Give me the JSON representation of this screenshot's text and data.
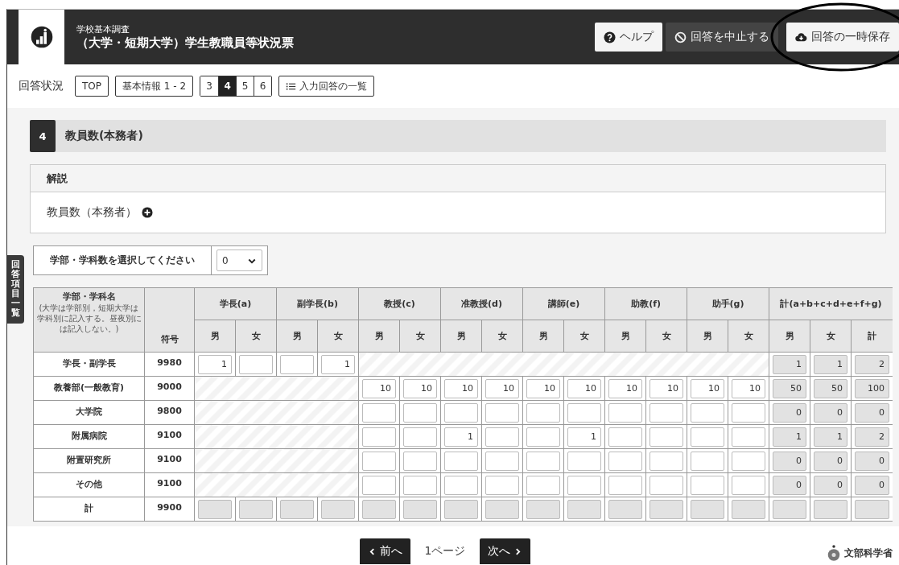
{
  "header": {
    "subtitle": "学校基本調査",
    "title": "（大学・短期大学）学生教職員等状況票",
    "buttons": [
      {
        "kind": "help",
        "label": "ヘルプ"
      },
      {
        "kind": "stop",
        "label": "回答を中止する"
      },
      {
        "kind": "save",
        "label": "回答の一時保存"
      }
    ]
  },
  "nav": {
    "status_label": "回答状況",
    "links": [
      "TOP",
      "基本情報 1 - 2"
    ],
    "pages": [
      {
        "label": "3",
        "selected": false
      },
      {
        "label": "4",
        "selected": true
      },
      {
        "label": "5",
        "selected": false
      },
      {
        "label": "6",
        "selected": false
      }
    ],
    "list_button": "入力回答の一覧"
  },
  "side_tab": "回答項目一覧",
  "section": {
    "number": "4",
    "title": "教員数(本務者)",
    "explanation": {
      "heading": "解説",
      "item": "教員数（本務者）"
    },
    "select": {
      "label": "学部・学科数を選択してください",
      "value": "0"
    }
  },
  "table": {
    "name_header": "学部・学科名",
    "name_note": "(大学は学部別，短期大学は学科別に記入する。昼夜別には記入しない。)",
    "code_header": "符号",
    "groups": [
      {
        "label": "学長(a)",
        "subs": [
          "男",
          "女"
        ]
      },
      {
        "label": "副学長(b)",
        "subs": [
          "男",
          "女"
        ]
      },
      {
        "label": "教授(c)",
        "subs": [
          "男",
          "女"
        ]
      },
      {
        "label": "准教授(d)",
        "subs": [
          "男",
          "女"
        ]
      },
      {
        "label": "講師(e)",
        "subs": [
          "男",
          "女"
        ]
      },
      {
        "label": "助教(f)",
        "subs": [
          "男",
          "女"
        ]
      },
      {
        "label": "助手(g)",
        "subs": [
          "男",
          "女"
        ]
      },
      {
        "label": "計(a+b+c+d+e+f+g)",
        "subs": [
          "男",
          "女",
          "計"
        ]
      }
    ],
    "rows": [
      {
        "name": "学長・副学長",
        "code": "9980",
        "cells": [
          {
            "kind": "input",
            "value": "1"
          },
          {
            "kind": "input"
          },
          {
            "kind": "input"
          },
          {
            "kind": "input",
            "value": "1"
          },
          {
            "kind": "hatched"
          },
          {
            "kind": "hatched"
          },
          {
            "kind": "hatched"
          },
          {
            "kind": "hatched"
          },
          {
            "kind": "hatched"
          },
          {
            "kind": "hatched"
          },
          {
            "kind": "hatched"
          },
          {
            "kind": "hatched"
          },
          {
            "kind": "hatched"
          },
          {
            "kind": "hatched"
          },
          {
            "kind": "total",
            "value": "1"
          },
          {
            "kind": "total",
            "value": "1"
          },
          {
            "kind": "total",
            "value": "2"
          }
        ]
      },
      {
        "name": "教養部(一般教育)",
        "code": "9000",
        "cells": [
          {
            "kind": "hatched"
          },
          {
            "kind": "hatched"
          },
          {
            "kind": "hatched"
          },
          {
            "kind": "hatched"
          },
          {
            "kind": "input",
            "value": "10"
          },
          {
            "kind": "input",
            "value": "10"
          },
          {
            "kind": "input",
            "value": "10"
          },
          {
            "kind": "input",
            "value": "10"
          },
          {
            "kind": "input",
            "value": "10"
          },
          {
            "kind": "input",
            "value": "10"
          },
          {
            "kind": "input",
            "value": "10"
          },
          {
            "kind": "input",
            "value": "10"
          },
          {
            "kind": "input",
            "value": "10"
          },
          {
            "kind": "input",
            "value": "10"
          },
          {
            "kind": "total",
            "value": "50"
          },
          {
            "kind": "total",
            "value": "50"
          },
          {
            "kind": "total",
            "value": "100"
          }
        ]
      },
      {
        "name": "大学院",
        "code": "9800",
        "cells": [
          {
            "kind": "hatched"
          },
          {
            "kind": "hatched"
          },
          {
            "kind": "hatched"
          },
          {
            "kind": "hatched"
          },
          {
            "kind": "input"
          },
          {
            "kind": "input"
          },
          {
            "kind": "input"
          },
          {
            "kind": "input"
          },
          {
            "kind": "input"
          },
          {
            "kind": "input"
          },
          {
            "kind": "input"
          },
          {
            "kind": "input"
          },
          {
            "kind": "input"
          },
          {
            "kind": "input"
          },
          {
            "kind": "total",
            "value": "0"
          },
          {
            "kind": "total",
            "value": "0"
          },
          {
            "kind": "total",
            "value": "0"
          }
        ]
      },
      {
        "name": "附属病院",
        "code": "9100",
        "cells": [
          {
            "kind": "hatched"
          },
          {
            "kind": "hatched"
          },
          {
            "kind": "hatched"
          },
          {
            "kind": "hatched"
          },
          {
            "kind": "input"
          },
          {
            "kind": "input"
          },
          {
            "kind": "input",
            "value": "1"
          },
          {
            "kind": "input"
          },
          {
            "kind": "input"
          },
          {
            "kind": "input",
            "value": "1"
          },
          {
            "kind": "input"
          },
          {
            "kind": "input"
          },
          {
            "kind": "input"
          },
          {
            "kind": "input"
          },
          {
            "kind": "total",
            "value": "1"
          },
          {
            "kind": "total",
            "value": "1"
          },
          {
            "kind": "total",
            "value": "2"
          }
        ]
      },
      {
        "name": "附置研究所",
        "code": "9100",
        "cells": [
          {
            "kind": "hatched"
          },
          {
            "kind": "hatched"
          },
          {
            "kind": "hatched"
          },
          {
            "kind": "hatched"
          },
          {
            "kind": "input"
          },
          {
            "kind": "input"
          },
          {
            "kind": "input"
          },
          {
            "kind": "input"
          },
          {
            "kind": "input"
          },
          {
            "kind": "input"
          },
          {
            "kind": "input"
          },
          {
            "kind": "input"
          },
          {
            "kind": "input"
          },
          {
            "kind": "input"
          },
          {
            "kind": "total",
            "value": "0"
          },
          {
            "kind": "total",
            "value": "0"
          },
          {
            "kind": "total",
            "value": "0"
          }
        ]
      },
      {
        "name": "その他",
        "code": "9100",
        "cells": [
          {
            "kind": "hatched"
          },
          {
            "kind": "hatched"
          },
          {
            "kind": "hatched"
          },
          {
            "kind": "hatched"
          },
          {
            "kind": "input"
          },
          {
            "kind": "input"
          },
          {
            "kind": "input"
          },
          {
            "kind": "input"
          },
          {
            "kind": "input"
          },
          {
            "kind": "input"
          },
          {
            "kind": "input"
          },
          {
            "kind": "input"
          },
          {
            "kind": "input"
          },
          {
            "kind": "input"
          },
          {
            "kind": "total",
            "value": "0"
          },
          {
            "kind": "total",
            "value": "0"
          },
          {
            "kind": "total",
            "value": "0"
          }
        ]
      },
      {
        "name": "計",
        "code": "9900",
        "cells": [
          {
            "kind": "total"
          },
          {
            "kind": "total"
          },
          {
            "kind": "total"
          },
          {
            "kind": "total"
          },
          {
            "kind": "total"
          },
          {
            "kind": "total"
          },
          {
            "kind": "total"
          },
          {
            "kind": "total"
          },
          {
            "kind": "total"
          },
          {
            "kind": "total"
          },
          {
            "kind": "total"
          },
          {
            "kind": "total"
          },
          {
            "kind": "total"
          },
          {
            "kind": "total"
          },
          {
            "kind": "total"
          },
          {
            "kind": "total"
          },
          {
            "kind": "total"
          }
        ]
      }
    ]
  },
  "footer": {
    "prev": "前へ",
    "page": "1ページ",
    "next": "次へ",
    "ministry": "文部科学省"
  }
}
